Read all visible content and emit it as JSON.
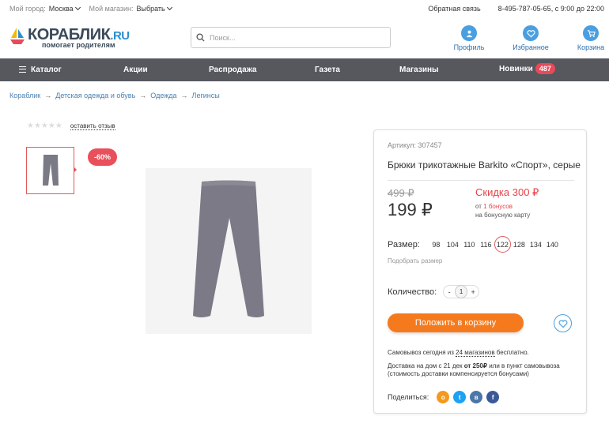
{
  "topbar": {
    "city_label": "Мой город:",
    "city_value": "Москва",
    "store_label": "Мой магазин:",
    "store_value": "Выбрать",
    "feedback": "Обратная связь",
    "phone": "8-495-787-05-65, с 9:00 до 22:00"
  },
  "header": {
    "logo_name": "КОРАБЛИК",
    "logo_tld": ".RU",
    "logo_tagline": "помогает родителям",
    "search_placeholder": "Поиск...",
    "profile": "Профиль",
    "favorites": "Избранное",
    "cart": "Корзина"
  },
  "nav": {
    "catalog": "Каталог",
    "items": [
      "Акции",
      "Распродажа",
      "Газета",
      "Магазины"
    ],
    "new_label": "Новинки",
    "new_count": "487"
  },
  "breadcrumbs": [
    "Кораблик",
    "Детская одежда и обувь",
    "Одежда",
    "Легинсы"
  ],
  "product": {
    "review_link": "оставить отзыв",
    "rating": 0,
    "discount_badge": "-60%",
    "article": "Артикул: 307457",
    "title": "Брюки трикотажные Barkito «Спорт», серые",
    "old_price": "499 ₽",
    "price": "199 ₽",
    "discount_text": "Скидка 300 ₽",
    "bonus_prefix": "от",
    "bonus_value": "1 бонусов",
    "bonus_suffix": "на бонусную карту",
    "size_label": "Размер:",
    "sizes": [
      "98",
      "104",
      "110",
      "116",
      "122",
      "128",
      "134",
      "140"
    ],
    "selected_size": "122",
    "size_help": "Подобрать размер",
    "qty_label": "Количество:",
    "qty_minus": "-",
    "qty_value": "1",
    "qty_plus": "+",
    "add_to_cart": "Положить в корзину",
    "pickup_pre": "Самовывоз сегодня из ",
    "pickup_link": "24 магазинов",
    "pickup_post": " бесплатно.",
    "delivery_pre": "Доставка на дом с 21 дек ",
    "delivery_bold": "от 250₽",
    "delivery_post": " или в пункт самовывоза (стоимость доставки компенсируется бонусами)",
    "share_label": "Поделиться:",
    "share_ok": "о",
    "share_tw": "t",
    "share_vk": "в",
    "share_fb": "f"
  },
  "colors": {
    "accent_blue": "#4a9fe0",
    "nav_bg": "#56585e",
    "cta_orange": "#f57a1e",
    "discount_red": "#e8424a"
  }
}
